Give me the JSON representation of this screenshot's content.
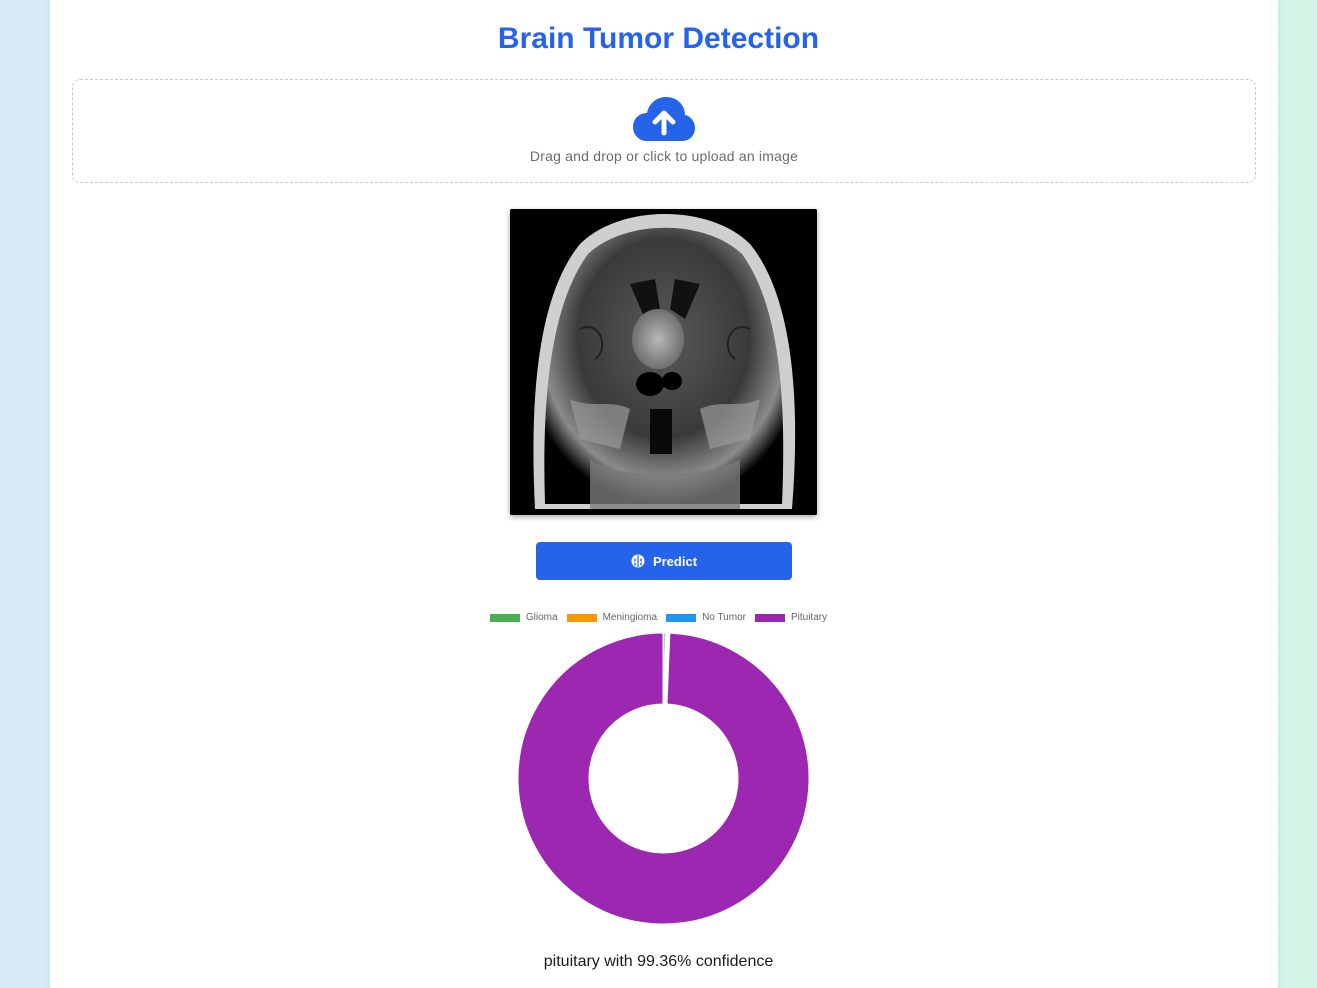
{
  "app": {
    "title": "Brain Tumor Detection"
  },
  "upload": {
    "prompt": "Drag and drop or click to upload an image",
    "icon": "cloud-upload-icon"
  },
  "preview": {
    "image_description_icon": "mri-scan-image"
  },
  "actions": {
    "predict_label": "Predict",
    "predict_icon": "brain-icon"
  },
  "colors": {
    "accent": "#2563eb",
    "glioma": "#4caf50",
    "meningioma": "#ff9800",
    "no_tumor": "#2196f3",
    "pituitary": "#9c27b0"
  },
  "chart_data": {
    "type": "doughnut",
    "categories": [
      "Glioma",
      "Meningioma",
      "No Tumor",
      "Pituitary"
    ],
    "values": [
      0.3,
      0.2,
      0.14,
      99.36
    ],
    "colors": [
      "#4caf50",
      "#ff9800",
      "#2196f3",
      "#9c27b0"
    ],
    "legend_position": "top"
  },
  "result": {
    "text": "pituitary with 99.36% confidence"
  }
}
